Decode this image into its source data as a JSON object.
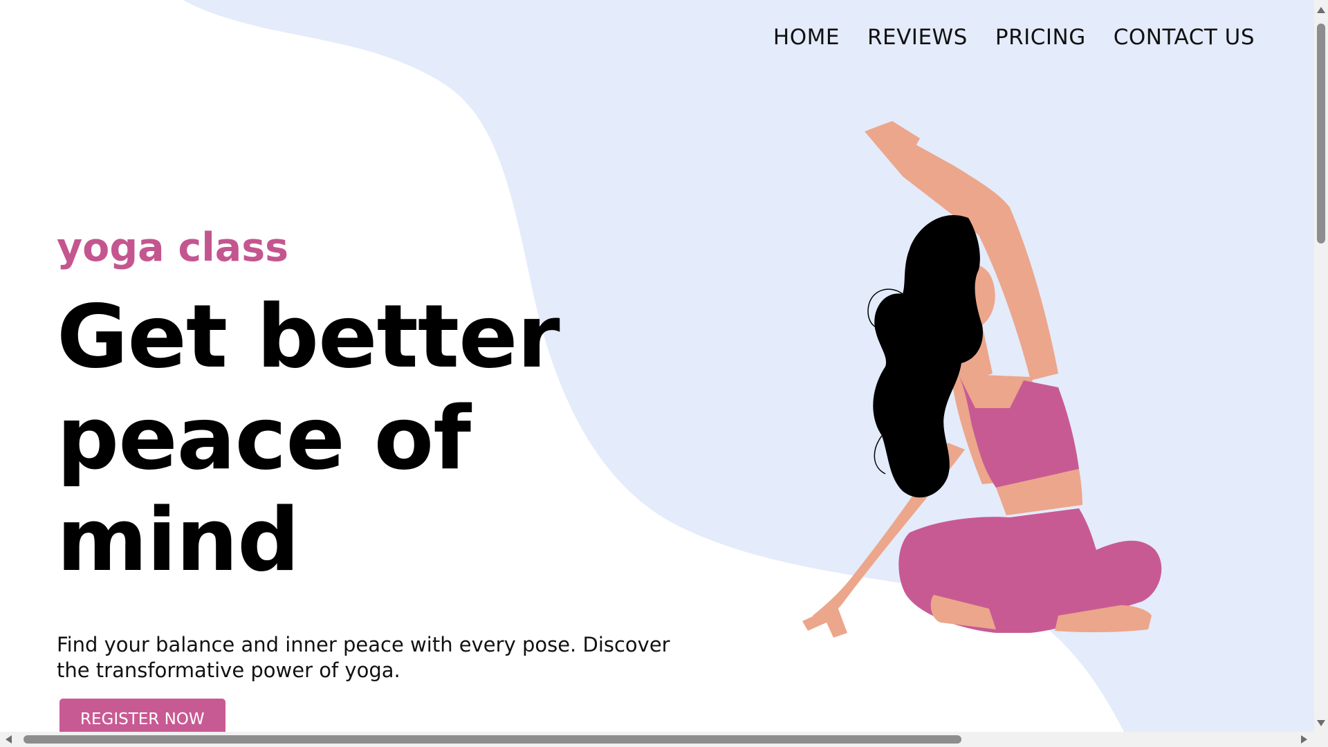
{
  "nav": {
    "items": [
      {
        "label": "HOME"
      },
      {
        "label": "REVIEWS"
      },
      {
        "label": "PRICING"
      },
      {
        "label": "CONTACT US"
      }
    ]
  },
  "hero": {
    "eyebrow": "yoga class",
    "headline_line1": "Get better",
    "headline_line2": "peace of mind",
    "description_line1": "Find your balance and inner peace with every pose. Discover",
    "description_line2": "the transformative power of yoga.",
    "cta_label": "REGISTER NOW"
  },
  "colors": {
    "background": "#ffffff",
    "blob": "#e4ebfa",
    "accent": "#c85a93",
    "text": "#111111",
    "skin": "#eca68b",
    "hair": "#000000"
  },
  "icons": [
    "yoga-woman-illustration",
    "scroll-arrow-up-icon",
    "scroll-arrow-down-icon",
    "scroll-arrow-left-icon",
    "scroll-arrow-right-icon"
  ]
}
